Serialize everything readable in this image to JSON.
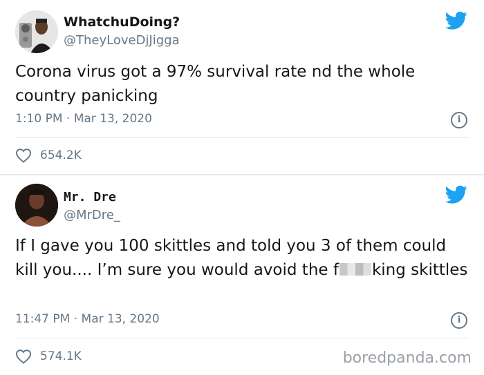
{
  "tweets": [
    {
      "name": "WhatchuDoing?",
      "handle": "@TheyLoveDjJigga",
      "text": "Corona virus got a 97% survival rate nd the whole country panicking",
      "time": "1:10 PM",
      "date": "Mar 13, 2020",
      "likes": "654.2K"
    },
    {
      "name": "Mr. Dre",
      "handle": "@MrDre_",
      "text_before": "If I gave you 100 skittles and told you 3 of them could kill you.... I’m sure you would avoid the f",
      "text_after": "king skittles",
      "time": "11:47 PM",
      "date": "Mar 13, 2020",
      "likes": "574.1K"
    }
  ],
  "separator": " · ",
  "watermark": "boredpanda.com",
  "colors": {
    "twitter_blue": "#1da1f2",
    "muted": "#657786",
    "text": "#14171a",
    "border": "#e1e8ed"
  },
  "icons": {
    "brand": "twitter-bird-icon",
    "info": "info-icon",
    "like": "heart-outline-icon"
  }
}
